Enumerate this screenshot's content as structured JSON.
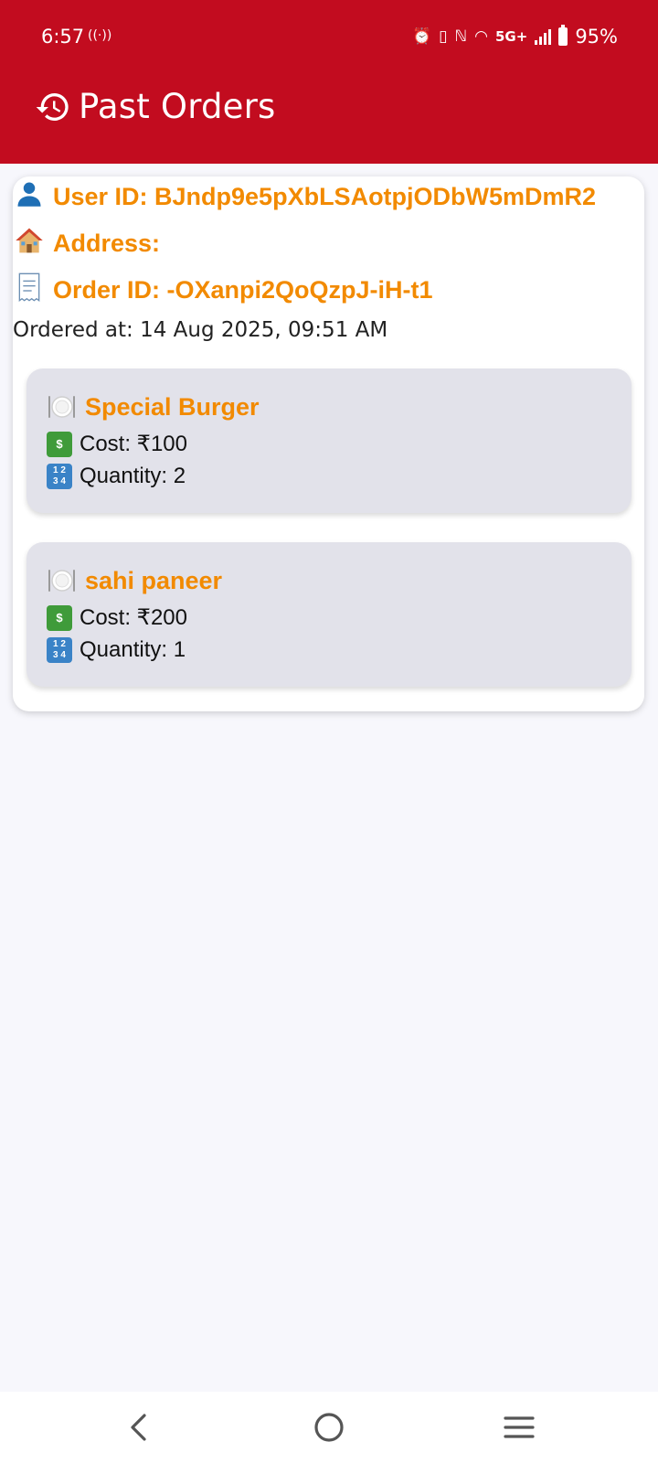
{
  "status_bar": {
    "time": "6:57",
    "network": "5G+",
    "battery": "95%"
  },
  "header": {
    "title": "Past Orders",
    "icon": "history-icon"
  },
  "order": {
    "user_id_label": "User ID: BJndp9e5pXbLSAotpjODbW5mDmR2",
    "address_label": "Address:",
    "order_id_label": "Order ID: -OXanpi2QoQzpJ-iH-t1",
    "ordered_at": "Ordered at: 14 Aug 2025, 09:51 AM",
    "items": [
      {
        "name": "Special Burger",
        "cost": "Cost: ₹100",
        "quantity": "Quantity: 2"
      },
      {
        "name": "sahi paneer",
        "cost": "Cost: ₹200",
        "quantity": "Quantity: 1"
      }
    ]
  },
  "colors": {
    "header_bg": "#c20c1f",
    "accent_orange": "#f28a00",
    "item_bg": "#e2e2ea"
  }
}
